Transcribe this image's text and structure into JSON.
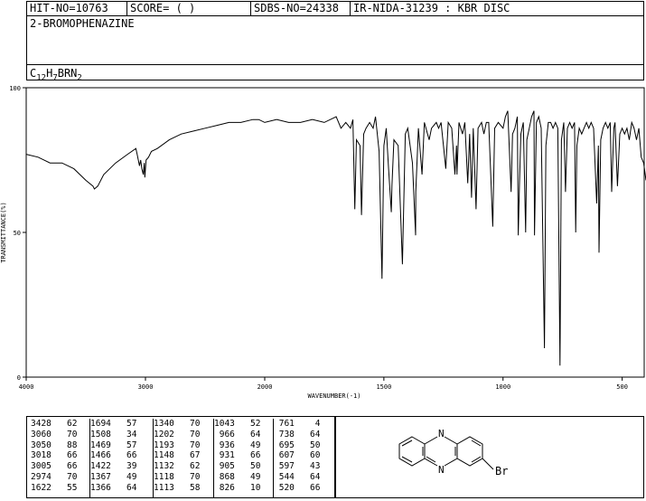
{
  "header": {
    "hit_no": "HIT-NO=10763",
    "score": "SCORE=  (   )",
    "sdbs_no": "SDBS-NO=24338",
    "ir_nida": "IR-NIDA-31239 : KBR DISC",
    "compound": "2-BROMOPHENAZINE",
    "formula": {
      "c": "C",
      "c_n": "12",
      "h": "H",
      "h_n": "7",
      "rest": "BRN",
      "n_n": "2"
    }
  },
  "chart_data": {
    "type": "line",
    "xlabel": "WAVENUMBER(-1)",
    "ylabel": "TRANSMITTANCE(%)",
    "xlim": [
      4000,
      400
    ],
    "ylim": [
      0,
      100
    ],
    "x_ticks": [
      4000,
      3000,
      2000,
      1500,
      1000,
      500
    ],
    "y_ticks": [
      0,
      50,
      100
    ],
    "series": [
      {
        "points": [
          [
            4000,
            77
          ],
          [
            3900,
            76
          ],
          [
            3800,
            74
          ],
          [
            3700,
            74
          ],
          [
            3600,
            72
          ],
          [
            3500,
            68
          ],
          [
            3440,
            66
          ],
          [
            3428,
            65
          ],
          [
            3400,
            66
          ],
          [
            3350,
            70
          ],
          [
            3250,
            74
          ],
          [
            3150,
            77
          ],
          [
            3080,
            79
          ],
          [
            3070,
            77
          ],
          [
            3060,
            75
          ],
          [
            3050,
            73
          ],
          [
            3040,
            75
          ],
          [
            3030,
            72
          ],
          [
            3018,
            70
          ],
          [
            3010,
            74
          ],
          [
            3005,
            69
          ],
          [
            2995,
            75
          ],
          [
            2974,
            76
          ],
          [
            2950,
            78
          ],
          [
            2900,
            79
          ],
          [
            2800,
            82
          ],
          [
            2700,
            84
          ],
          [
            2600,
            85
          ],
          [
            2500,
            86
          ],
          [
            2400,
            87
          ],
          [
            2300,
            88
          ],
          [
            2200,
            88
          ],
          [
            2100,
            89
          ],
          [
            2050,
            89
          ],
          [
            2000,
            88
          ],
          [
            1950,
            89
          ],
          [
            1900,
            88
          ],
          [
            1850,
            88
          ],
          [
            1800,
            89
          ],
          [
            1750,
            88
          ],
          [
            1700,
            90
          ],
          [
            1680,
            86
          ],
          [
            1660,
            88
          ],
          [
            1640,
            86
          ],
          [
            1630,
            89
          ],
          [
            1622,
            58
          ],
          [
            1615,
            82
          ],
          [
            1600,
            80
          ],
          [
            1594,
            56
          ],
          [
            1585,
            84
          ],
          [
            1575,
            86
          ],
          [
            1560,
            88
          ],
          [
            1545,
            86
          ],
          [
            1535,
            90
          ],
          [
            1520,
            78
          ],
          [
            1508,
            34
          ],
          [
            1500,
            80
          ],
          [
            1490,
            86
          ],
          [
            1480,
            72
          ],
          [
            1469,
            57
          ],
          [
            1466,
            66
          ],
          [
            1458,
            82
          ],
          [
            1440,
            80
          ],
          [
            1422,
            39
          ],
          [
            1410,
            84
          ],
          [
            1400,
            86
          ],
          [
            1380,
            74
          ],
          [
            1367,
            49
          ],
          [
            1366,
            64
          ],
          [
            1355,
            86
          ],
          [
            1340,
            70
          ],
          [
            1330,
            88
          ],
          [
            1310,
            82
          ],
          [
            1300,
            86
          ],
          [
            1280,
            88
          ],
          [
            1270,
            86
          ],
          [
            1260,
            88
          ],
          [
            1240,
            72
          ],
          [
            1230,
            88
          ],
          [
            1215,
            86
          ],
          [
            1202,
            70
          ],
          [
            1195,
            80
          ],
          [
            1193,
            70
          ],
          [
            1185,
            88
          ],
          [
            1170,
            84
          ],
          [
            1160,
            88
          ],
          [
            1148,
            67
          ],
          [
            1140,
            84
          ],
          [
            1132,
            62
          ],
          [
            1125,
            86
          ],
          [
            1118,
            70
          ],
          [
            1113,
            58
          ],
          [
            1105,
            86
          ],
          [
            1090,
            88
          ],
          [
            1080,
            84
          ],
          [
            1070,
            88
          ],
          [
            1060,
            88
          ],
          [
            1043,
            52
          ],
          [
            1035,
            86
          ],
          [
            1020,
            88
          ],
          [
            1000,
            86
          ],
          [
            990,
            90
          ],
          [
            980,
            92
          ],
          [
            966,
            64
          ],
          [
            960,
            84
          ],
          [
            950,
            86
          ],
          [
            940,
            90
          ],
          [
            936,
            49
          ],
          [
            931,
            66
          ],
          [
            925,
            84
          ],
          [
            915,
            88
          ],
          [
            905,
            50
          ],
          [
            900,
            82
          ],
          [
            890,
            86
          ],
          [
            880,
            90
          ],
          [
            870,
            92
          ],
          [
            868,
            49
          ],
          [
            860,
            88
          ],
          [
            850,
            90
          ],
          [
            840,
            86
          ],
          [
            826,
            10
          ],
          [
            820,
            80
          ],
          [
            810,
            88
          ],
          [
            800,
            88
          ],
          [
            790,
            86
          ],
          [
            780,
            88
          ],
          [
            770,
            86
          ],
          [
            761,
            4
          ],
          [
            755,
            82
          ],
          [
            745,
            88
          ],
          [
            738,
            64
          ],
          [
            730,
            86
          ],
          [
            720,
            88
          ],
          [
            710,
            86
          ],
          [
            700,
            88
          ],
          [
            695,
            50
          ],
          [
            690,
            80
          ],
          [
            680,
            86
          ],
          [
            670,
            84
          ],
          [
            660,
            86
          ],
          [
            650,
            88
          ],
          [
            640,
            86
          ],
          [
            630,
            88
          ],
          [
            620,
            86
          ],
          [
            607,
            60
          ],
          [
            600,
            80
          ],
          [
            597,
            43
          ],
          [
            590,
            82
          ],
          [
            580,
            86
          ],
          [
            570,
            88
          ],
          [
            560,
            86
          ],
          [
            550,
            88
          ],
          [
            544,
            64
          ],
          [
            535,
            86
          ],
          [
            530,
            88
          ],
          [
            520,
            66
          ],
          [
            510,
            84
          ],
          [
            500,
            86
          ],
          [
            490,
            84
          ],
          [
            480,
            86
          ],
          [
            470,
            82
          ],
          [
            460,
            88
          ],
          [
            450,
            86
          ],
          [
            440,
            82
          ],
          [
            430,
            86
          ],
          [
            420,
            76
          ],
          [
            410,
            74
          ],
          [
            400,
            68
          ]
        ]
      }
    ]
  },
  "peaks": {
    "columns": [
      [
        [
          "3428",
          "62"
        ],
        [
          "3060",
          "70"
        ],
        [
          "3050",
          "88"
        ],
        [
          "3018",
          "66"
        ],
        [
          "3005",
          "66"
        ],
        [
          "2974",
          "70"
        ],
        [
          "1622",
          "55"
        ]
      ],
      [
        [
          "1694",
          "57"
        ],
        [
          "1508",
          "34"
        ],
        [
          "1469",
          "57"
        ],
        [
          "1466",
          "66"
        ],
        [
          "1422",
          "39"
        ],
        [
          "1367",
          "49"
        ],
        [
          "1366",
          "64"
        ]
      ],
      [
        [
          "1340",
          "70"
        ],
        [
          "1202",
          "70"
        ],
        [
          "1193",
          "70"
        ],
        [
          "1148",
          "67"
        ],
        [
          "1132",
          "62"
        ],
        [
          "1118",
          "70"
        ],
        [
          "1113",
          "58"
        ]
      ],
      [
        [
          "1043",
          "52"
        ],
        [
          "966",
          "64"
        ],
        [
          "936",
          "49"
        ],
        [
          "931",
          "66"
        ],
        [
          "905",
          "50"
        ],
        [
          "868",
          "49"
        ],
        [
          "826",
          "10"
        ]
      ],
      [
        [
          "761",
          "4"
        ],
        [
          "738",
          "64"
        ],
        [
          "695",
          "50"
        ],
        [
          "607",
          "60"
        ],
        [
          "597",
          "43"
        ],
        [
          "544",
          "64"
        ],
        [
          "520",
          "66"
        ]
      ]
    ]
  },
  "structure": {
    "label_n_top": "N",
    "label_n_bottom": "N",
    "label_br": "Br"
  }
}
